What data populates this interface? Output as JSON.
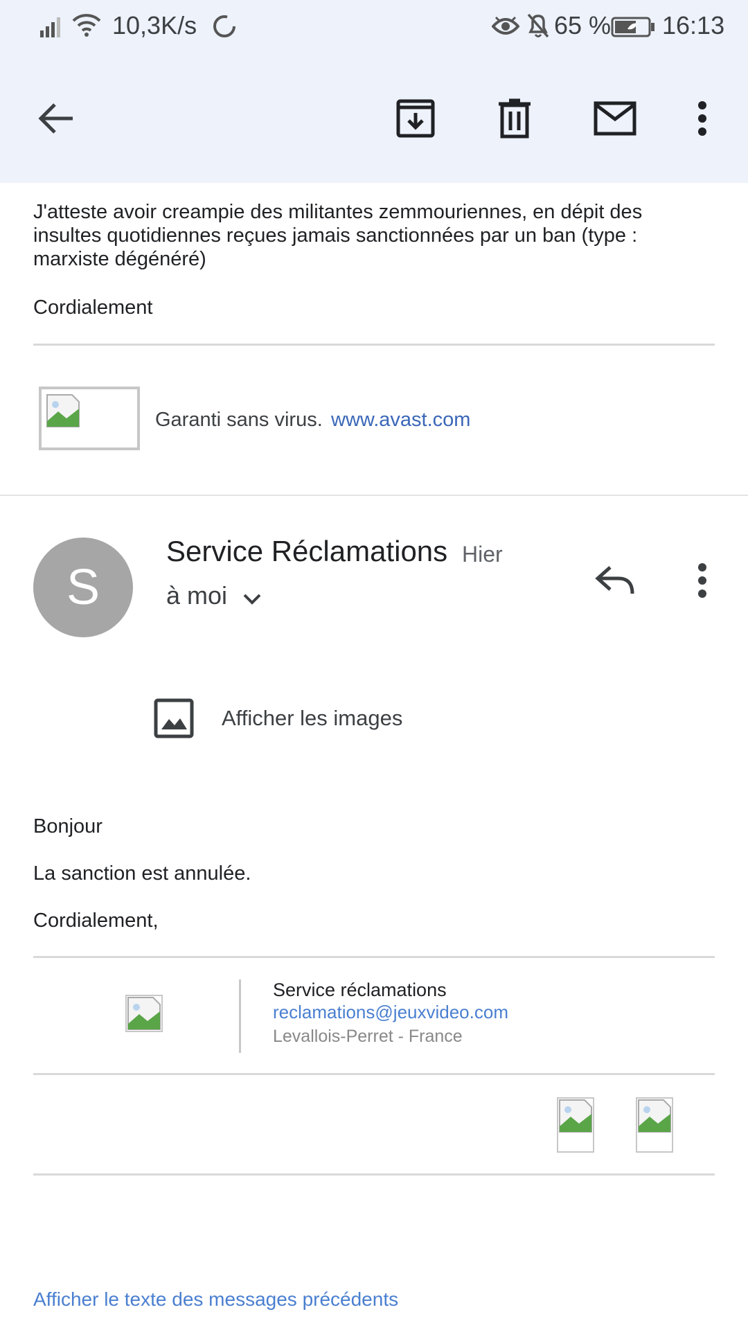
{
  "status_bar": {
    "net_speed": "10,3K/s",
    "battery": "65 %",
    "time": "16:13"
  },
  "toolbar": {
    "back_icon": "arrow-left-icon",
    "archive_icon": "archive-icon",
    "delete_icon": "trash-icon",
    "unread_icon": "mail-icon",
    "more_icon": "more-vert-icon"
  },
  "previous_message": {
    "body": "J'atteste avoir creampie des militantes zemmouriennes, en dépit des insultes quotidiennes reçues jamais sanctionnées par un ban (type : marxiste dégénéré)",
    "closing": "Cordialement",
    "footer_text": "Garanti sans virus.",
    "footer_link": "www.avast.com"
  },
  "message": {
    "avatar_letter": "S",
    "sender": "Service Réclamations",
    "date": "Hier",
    "recipient": "à moi",
    "show_images": "Afficher les images",
    "greeting": "Bonjour",
    "body": "La sanction est annulée.",
    "closing": "Cordialement,",
    "signature": {
      "name": "Service réclamations",
      "email": "reclamations@jeuxvideo.com",
      "location": "Levallois-Perret - France"
    },
    "show_quoted": "Afficher le texte des messages précédents"
  },
  "colors": {
    "header_bg": "#edf2fb",
    "link": "#3b67b8",
    "avatar_bg": "#a6a6a6"
  }
}
